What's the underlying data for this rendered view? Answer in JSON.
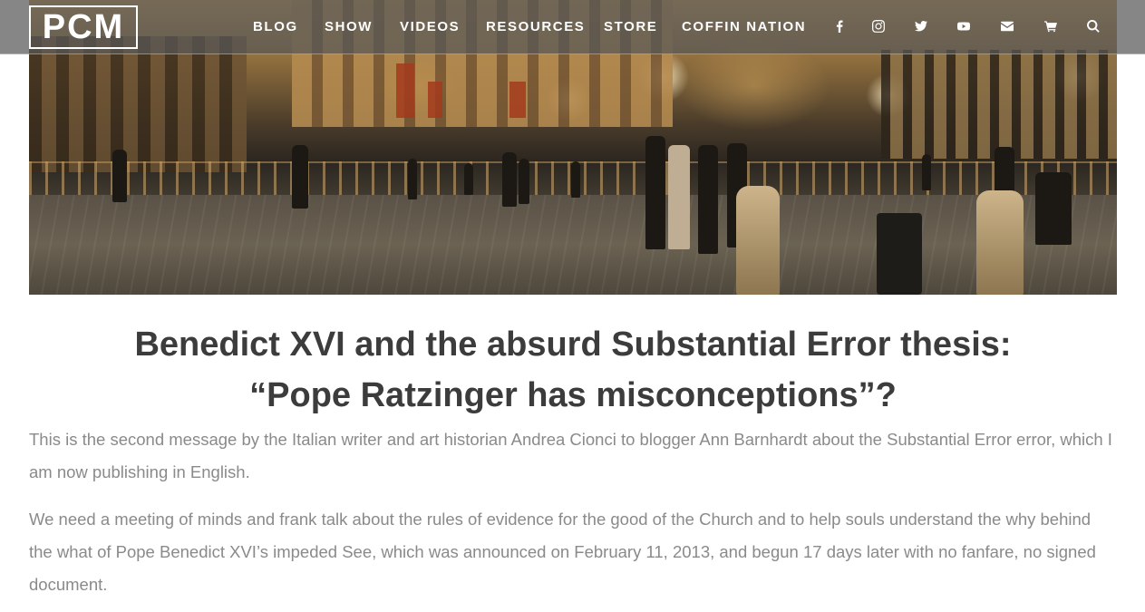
{
  "header": {
    "logo_text": "PCM",
    "nav": [
      {
        "label": "BLOG"
      },
      {
        "label": "SHOW"
      },
      {
        "label": "VIDEOS"
      },
      {
        "label": "RESOURCES"
      },
      {
        "label": "STORE"
      },
      {
        "label": "COFFIN NATION"
      }
    ],
    "icons": [
      "facebook-icon",
      "instagram-icon",
      "twitter-icon",
      "youtube-icon",
      "envelope-icon",
      "cart-icon",
      "search-icon"
    ]
  },
  "hero": {
    "subject": "night plaza with lit colonnade and people"
  },
  "article": {
    "title_line1": "Benedict XVI and the absurd Substantial Error thesis:",
    "title_line2": "“Pope Ratzinger has misconceptions”?",
    "paragraphs": [
      "This is the second message by the Italian writer and art historian Andrea Cionci to blogger Ann Barnhardt about the Substantial Error error, which I am now publishing in English.",
      "We need a meeting of minds and frank talk about the rules of evidence for the good of the Church and to help souls understand the why behind the what of Pope Benedict XVI’s impeded See, which was announced on February 11, 2013, and begun 17 days later with no fanfare, no signed document."
    ]
  },
  "colors": {
    "header_bg": "#585858",
    "title": "#3c3c3c",
    "body_text": "#8a8a8a"
  }
}
